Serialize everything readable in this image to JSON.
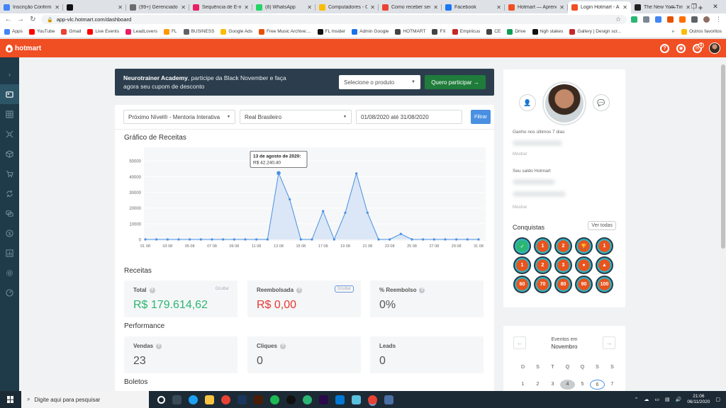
{
  "browser": {
    "tabs": [
      {
        "title": "Inscrição Confirmad",
        "color": "#4285f4",
        "active": false
      },
      {
        "title": "",
        "color": "#111111",
        "active": false
      },
      {
        "title": "(99+) Gerenciador",
        "color": "#6c6c6c",
        "active": false
      },
      {
        "title": "Sequência de E-mai",
        "color": "#e91e63",
        "active": false
      },
      {
        "title": "(8) WhatsApp",
        "color": "#25d366",
        "active": false
      },
      {
        "title": "Computadores - Go",
        "color": "#fbbc04",
        "active": false
      },
      {
        "title": "Como receber seu",
        "color": "#ea4335",
        "active": false
      },
      {
        "title": "Facebook",
        "color": "#1877f2",
        "active": false
      },
      {
        "title": "Hotmart — Aprend",
        "color": "#f04e23",
        "active": false
      },
      {
        "title": "Login Hotmart - Ap",
        "color": "#f04e23",
        "active": true
      },
      {
        "title": "The New York Times",
        "color": "#222222",
        "active": false
      }
    ],
    "url": "app-vlc.hotmart.com/dashboard",
    "bookmarks": [
      {
        "label": "Apps",
        "color": "#4285f4"
      },
      {
        "label": "YouTube",
        "color": "#ff0000"
      },
      {
        "label": "Gmail",
        "color": "#ea4335"
      },
      {
        "label": "Live Events",
        "color": "#ff0000"
      },
      {
        "label": "LeadLovers",
        "color": "#e91e63"
      },
      {
        "label": "FL",
        "color": "#ff9800"
      },
      {
        "label": "BUSINESS",
        "color": "#5f6368"
      },
      {
        "label": "Google Ads",
        "color": "#fbbc04"
      },
      {
        "label": "Free Music Archive:...",
        "color": "#e65100"
      },
      {
        "label": "FL Insider",
        "color": "#111111"
      },
      {
        "label": "Admin Google",
        "color": "#1a73e8"
      },
      {
        "label": "HOTMART",
        "color": "#444444"
      },
      {
        "label": "FX",
        "color": "#444444"
      },
      {
        "label": "Empiricus",
        "color": "#c62828"
      },
      {
        "label": "CE",
        "color": "#444444"
      },
      {
        "label": "Drive",
        "color": "#0f9d58"
      },
      {
        "label": "high stakes",
        "color": "#111111"
      },
      {
        "label": "Gallery | Design scr...",
        "color": "#c62828"
      }
    ],
    "bookmarks_more": "»",
    "other_bookmarks": "Outros favoritos"
  },
  "hotmart": {
    "brand": "hotmart",
    "notif_count": "6"
  },
  "promo": {
    "bold": "Neurotrainer Academy",
    "text": ", participe da Black November e faça agora seu cupom de desconto",
    "select_placeholder": "Selecione o produto",
    "button": "Quero participar →"
  },
  "filters": {
    "product": "Próximo Nível® - Mentoria Interativa",
    "currency": "Real Brasileiro",
    "period": "01/08/2020 até 31/08/2020",
    "button": "Filtrar"
  },
  "chart_title": "Gráfico de Receitas",
  "chart_data": {
    "type": "area",
    "x": [
      "01/08",
      "02/08",
      "03/08",
      "04/08",
      "05/08",
      "06/08",
      "07/08",
      "08/08",
      "09/08",
      "10/08",
      "11/08",
      "12/08",
      "13/08",
      "14/08",
      "15/08",
      "16/08",
      "17/08",
      "18/08",
      "19/08",
      "20/08",
      "21/08",
      "22/08",
      "23/08",
      "24/08",
      "25/08",
      "26/08",
      "27/08",
      "28/08",
      "29/08",
      "30/08",
      "31/08"
    ],
    "x_tick_labels": [
      "01 08",
      "03 08",
      "05 08",
      "07 08",
      "09 08",
      "11 08",
      "13 08",
      "15 08",
      "17 08",
      "19 08",
      "21 08",
      "23 08",
      "25 08",
      "27 08",
      "29 08",
      "31 08"
    ],
    "y": [
      0,
      0,
      0,
      0,
      0,
      0,
      0,
      0,
      0,
      0,
      0,
      0,
      42240.4,
      25500,
      0,
      0,
      18000,
      0,
      17000,
      42000,
      17000,
      0,
      0,
      3500,
      0,
      0,
      0,
      0,
      0,
      0,
      0
    ],
    "ylim": [
      0,
      55000
    ],
    "y_ticks": [
      0,
      10000,
      20000,
      30000,
      40000,
      50000
    ],
    "grid": true,
    "line_color": "#4a90e2",
    "fill_color": "#dbe7f6",
    "tooltip": {
      "index": 12,
      "title": "13 de agosto de 2020:",
      "value": "R$ 42.240,40"
    }
  },
  "receitas": {
    "section": "Receitas",
    "total_label": "Total",
    "total_value": "R$ 179.614,62",
    "total_hide": "Ocultar",
    "reemb_label": "Reembolsada",
    "reemb_value": "R$ 0,00",
    "reemb_hide": "Ocultar",
    "pct_label": "% Reembolso",
    "pct_value": "0%"
  },
  "performance": {
    "section": "Performance",
    "vendas_label": "Vendas",
    "vendas_value": "23",
    "cliques_label": "Cliques",
    "cliques_value": "0",
    "leads_label": "Leads",
    "leads_value": "0"
  },
  "boletos": {
    "section": "Boletos"
  },
  "profile": {
    "earned_label": "Ganho nos últimos 7 dias",
    "earned_show": "Mostrar",
    "balance_label": "Seu saldo Hotmart",
    "balance_show": "Mostrar",
    "conquistas": "Conquistas",
    "ver_todas": "Ver todas",
    "badges": [
      {
        "text": "✓",
        "color": "#2bb673"
      },
      {
        "text": "1",
        "color": "#e8541e"
      },
      {
        "text": "2",
        "color": "#e8541e"
      },
      {
        "text": "🏆",
        "color": "#e8541e"
      },
      {
        "text": "1",
        "color": "#e8541e"
      },
      {
        "text": "1",
        "color": "#e8541e"
      },
      {
        "text": "2",
        "color": "#e8541e"
      },
      {
        "text": "3",
        "color": "#e8541e"
      },
      {
        "text": "●",
        "color": "#e8541e"
      },
      {
        "text": "▲",
        "color": "#e8541e"
      },
      {
        "text": "60",
        "color": "#e8541e"
      },
      {
        "text": "70",
        "color": "#e8541e"
      },
      {
        "text": "80",
        "color": "#e8541e"
      },
      {
        "text": "90",
        "color": "#e8541e"
      },
      {
        "text": "100",
        "color": "#e8541e"
      }
    ]
  },
  "calendar": {
    "label": "Eventos em",
    "month": "Novembro",
    "weekdays": [
      "D",
      "S",
      "T",
      "Q",
      "Q",
      "S",
      "S"
    ],
    "days": [
      "1",
      "2",
      "3",
      "4",
      "5",
      "6",
      "7"
    ],
    "today": "4",
    "selected": "6"
  },
  "taskbar": {
    "search_placeholder": "Digite aqui para pesquisar",
    "time": "21:06",
    "date": "06/11/2020"
  }
}
